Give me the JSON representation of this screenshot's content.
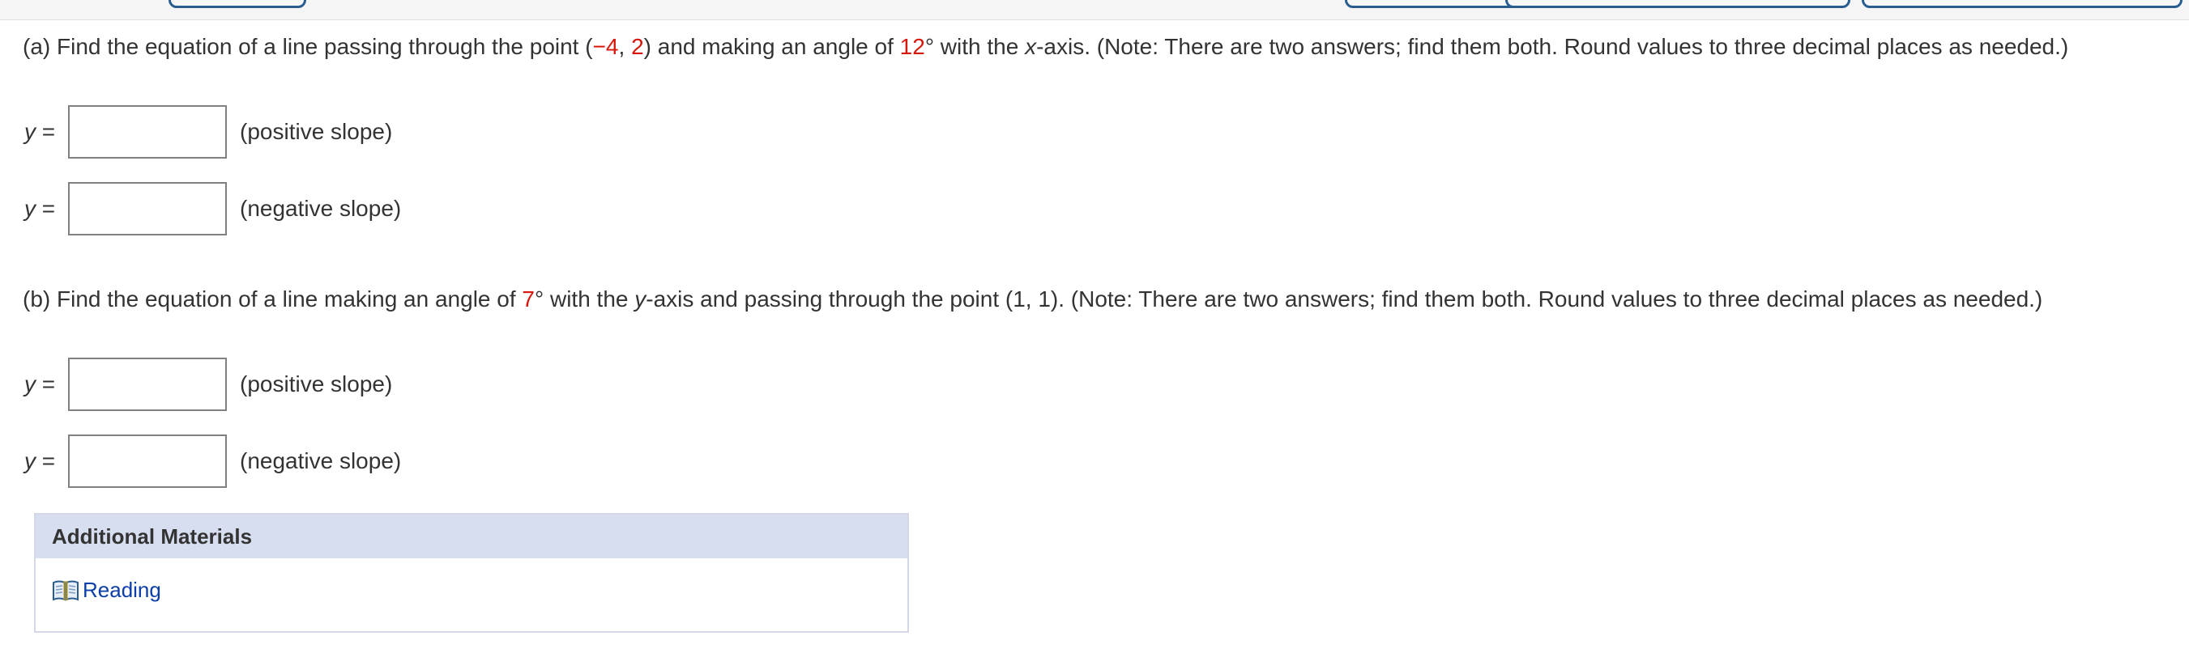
{
  "colors": {
    "accent_red": "#d6170b",
    "link_blue": "#0b3ea8",
    "materials_header_bg": "#d6deef"
  },
  "part_a": {
    "label": "(a) Find the equation of a line passing through the point ",
    "point_open": "(",
    "point_x": "−4",
    "point_sep": ", ",
    "point_y": "2",
    "point_close": ")",
    "mid": " and making an angle of ",
    "angle": "12",
    "degree": "°",
    "with_the": " with the ",
    "axis_var": "x",
    "axis_suffix": "-axis. (Note: There are two answers; find them both. Round values to three decimal places as needed.)",
    "answers": [
      {
        "lhs_var": "y",
        "lhs_eq": " =",
        "value": "",
        "note": "(positive slope)"
      },
      {
        "lhs_var": "y",
        "lhs_eq": " =",
        "value": "",
        "note": "(negative slope)"
      }
    ]
  },
  "part_b": {
    "label": "(b) Find the equation of a line making an angle of ",
    "angle": "7",
    "degree": "°",
    "with_the": " with the ",
    "axis_var": "y",
    "axis_suffix": "-axis and passing through the point  (1, 1).  (Note: There are two answers; find them both. Round values to three decimal places as needed.)",
    "answers": [
      {
        "lhs_var": "y",
        "lhs_eq": " =",
        "value": "",
        "note": "(positive slope)"
      },
      {
        "lhs_var": "y",
        "lhs_eq": " =",
        "value": "",
        "note": "(negative slope)"
      }
    ]
  },
  "additional_materials": {
    "title": "Additional Materials",
    "link_icon": "book-icon",
    "link_label": "Reading"
  }
}
